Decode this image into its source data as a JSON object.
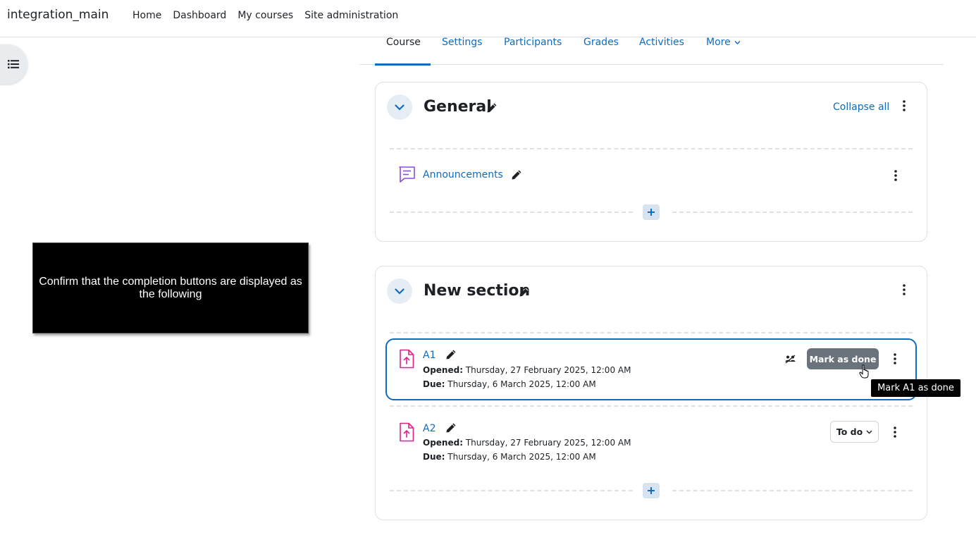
{
  "navbar": {
    "brand": "integration_main",
    "links": [
      "Home",
      "Dashboard",
      "My courses",
      "Site administration"
    ]
  },
  "drawer": {
    "icon": "list-icon"
  },
  "secondary_nav": {
    "tabs": [
      "Course",
      "Settings",
      "Participants",
      "Grades",
      "Activities",
      "More"
    ],
    "active": "Course"
  },
  "sections": [
    {
      "title": "General",
      "collapse_all_label": "Collapse all",
      "activities": [
        {
          "name": "Announcements",
          "icon": "forum-icon"
        }
      ]
    },
    {
      "title": "New section",
      "activities": [
        {
          "name": "A1",
          "icon": "assignment-icon",
          "opened_label": "Opened:",
          "opened": "Thursday, 27 February 2025, 12:00 AM",
          "due_label": "Due:",
          "due": "Thursday, 6 March 2025, 12:00 AM",
          "completion_button": "Mark as done",
          "tooltip": "Mark A1 as done"
        },
        {
          "name": "A2",
          "icon": "assignment-icon",
          "opened_label": "Opened:",
          "opened": "Thursday, 27 February 2025, 12:00 AM",
          "due_label": "Due:",
          "due": "Thursday, 6 March 2025, 12:00 AM",
          "completion_button": "To do"
        }
      ]
    }
  ],
  "overlay_note": "Confirm that the completion buttons are displayed as the following",
  "colors": {
    "link": "#0f6cbf",
    "forum_icon": "#8a4dd9",
    "assign_icon": "#e0218a",
    "button_grey": "#6a737b"
  }
}
